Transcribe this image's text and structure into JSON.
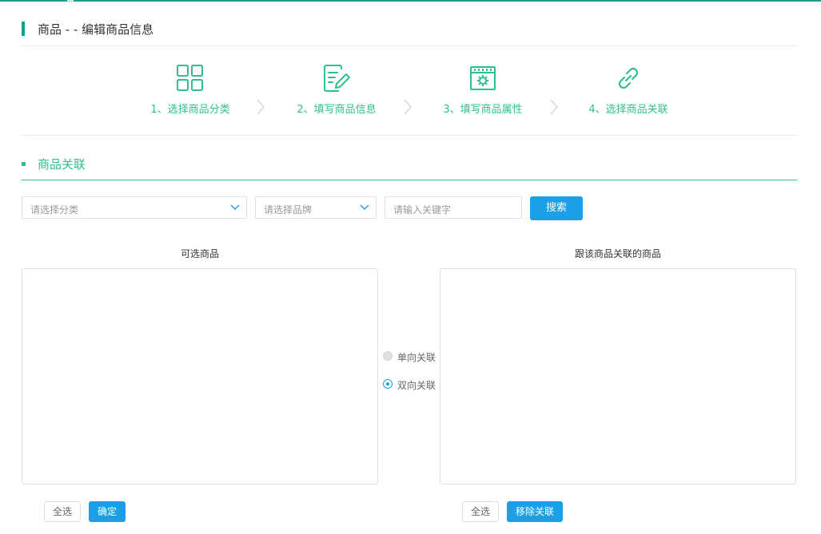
{
  "page": {
    "title": "商品 - - 编辑商品信息"
  },
  "steps": [
    {
      "label": "1、选择商品分类",
      "icon": "grid-category-icon"
    },
    {
      "label": "2、填写商品信息",
      "icon": "edit-document-icon"
    },
    {
      "label": "3、填写商品属性",
      "icon": "settings-window-icon"
    },
    {
      "label": "4、选择商品关联",
      "icon": "link-icon"
    }
  ],
  "section": {
    "title": "商品关联"
  },
  "filters": {
    "category_placeholder": "请选择分类",
    "brand_placeholder": "请选择品牌",
    "keyword_placeholder": "请输入关键字",
    "search_label": "搜索"
  },
  "left_panel": {
    "title": "可选商品",
    "select_all_label": "全选",
    "confirm_label": "确定"
  },
  "association": {
    "options": [
      "单向关联",
      "双向关联"
    ],
    "selected": "双向关联"
  },
  "right_panel": {
    "title": "跟该商品关联的商品",
    "select_all_label": "全选",
    "remove_label": "移除关联"
  },
  "colors": {
    "accent_green": "#2fbf8f",
    "header_bar": "#17a085",
    "primary_blue": "#1aa0e9"
  }
}
